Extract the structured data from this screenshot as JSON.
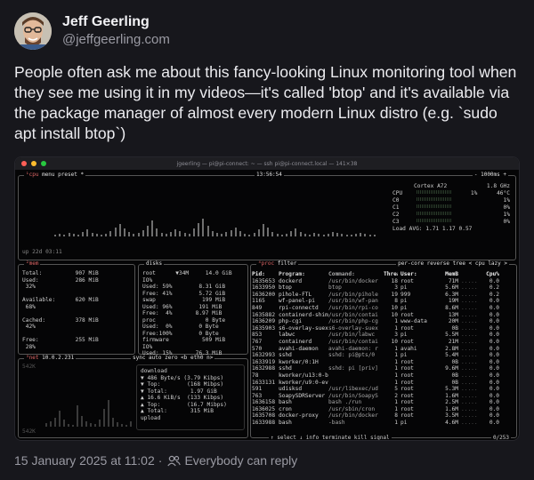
{
  "author": {
    "name": "Jeff Geerling",
    "handle": "@jeffgeerling.com"
  },
  "post": {
    "text": "People often ask me about this fancy-looking Linux monitoring tool when they see me using it in my videos—it's called 'btop' and it's available via the package manager of almost every modern Linux distro (e.g. `sudo apt install btop`)",
    "date": "15 January 2025 at 11:02",
    "reply_setting": "Everybody can reply"
  },
  "screenshot": {
    "window_title": "jgeerling — pi@pi-connect: ~ — ssh pi@pi-connect.local — 141×38",
    "cpu_box_label": "¹cpu",
    "cpu_menu": "menu",
    "cpu_preset": "preset *",
    "clock": "13:56:54",
    "refresh": "- 1000ms +",
    "uptime": "up 22d 03:11",
    "cpu_model": "Cortex A72",
    "cpu_freq": "1.8 GHz",
    "cpu_rows": [
      {
        "label": "CPU",
        "value": "1%",
        "extra": "46°C"
      },
      {
        "label": "C0",
        "value": "",
        "extra": "1%"
      },
      {
        "label": "C1",
        "value": "",
        "extra": "0%"
      },
      {
        "label": "C2",
        "value": "",
        "extra": "1%"
      },
      {
        "label": "C3",
        "value": "",
        "extra": "0%"
      }
    ],
    "load_avg": "Load AVG:   1.71   1.17   0.57",
    "mem": {
      "label": "²mem",
      "lines": [
        "Total:          907 MiB",
        "Used:           286 MiB",
        " 32%",
        "",
        "Available:      620 MiB",
        " 68%",
        "",
        "Cached:         378 MiB",
        " 42%",
        "",
        "Free:           255 MiB",
        " 28%"
      ]
    },
    "disks": {
      "label": "disks",
      "lines": [
        "root      ▼34M     14.0 GiB",
        "IO%",
        "Used: 59%        8.31 GiB",
        "Free: 41%        5.72 GiB",
        "swap              199 MiB",
        "Used: 96%        191 MiB",
        "Free:  4%       8.97 MiB",
        "proc               0 Byte",
        "Used:  0%        0 Byte",
        "Free:100%        0 Byte",
        "firmware          509 MiB",
        "IO%",
        "Used: 15%       76.3 MiB"
      ]
    },
    "net": {
      "label": "³net",
      "ip": "10.0.2.231",
      "controls": "sync  auto  zero  <b eth0 n>",
      "scale_top": "542K",
      "scale_bottom": "542K",
      "lines": [
        "download",
        "▼ 486 Byte/s (3.79 Kibps)",
        "▼ Top:        (168 Mibps)",
        "▼ Total:       1.97 GiB",
        "▲ 16.6 KiB/s  (133 Kibps)",
        "▲ Top:        (16.7 Mibps)",
        "▲ Total:       315 MiB",
        "upload"
      ]
    },
    "proc": {
      "label": "⁴proc",
      "filter": "filter",
      "controls": "per-core  reverse  tree  < cpu lazy >",
      "headers": [
        "Pid:",
        "Program:",
        "Command:",
        "Threads:",
        "User:",
        "MemB",
        "",
        "Cpu%"
      ],
      "rows": [
        [
          "1635653",
          "dockerd",
          "/usr/bin/docker",
          "18",
          "root",
          "71M",
          "",
          "0.0"
        ],
        [
          "1633950",
          "btop",
          "btop",
          "3",
          "pi",
          "5.6M",
          "",
          "0.2"
        ],
        [
          "1636200",
          "pihole-FTL",
          "/usr/bin/pihole",
          "19",
          "999",
          "6.3M",
          "",
          "0.2"
        ],
        [
          "1165",
          "wf-panel-pi",
          "/usr/bin/wf-pan",
          "8",
          "pi",
          "19M",
          "",
          "0.0"
        ],
        [
          "849",
          "rpi-connectd",
          "/usr/bin/rpi-co",
          "10",
          "pi",
          "8.6M",
          "",
          "0.0"
        ],
        [
          "1635882",
          "containerd-shim",
          "/usr/bin/contai",
          "10",
          "root",
          "13M",
          "",
          "0.0"
        ],
        [
          "1636209",
          "php-cgi",
          "/usr/bin/php-cg",
          "1",
          "www-data",
          "20M",
          "",
          "0.0"
        ],
        [
          "1635903",
          "s6-overlay-suex",
          "s6-overlay-suex",
          "1",
          "root",
          "0B",
          "",
          "0.0"
        ],
        [
          "853",
          "labwc",
          "/usr/bin/labwc",
          "3",
          "pi",
          "5.5M",
          "",
          "0.0"
        ],
        [
          "767",
          "containerd",
          "/usr/bin/contai",
          "10",
          "root",
          "21M",
          "",
          "0.0"
        ],
        [
          "570",
          "avahi-daemon",
          "avahi-daemon: r",
          "1",
          "avahi",
          "2.8M",
          "",
          "0.0"
        ],
        [
          "1632993",
          "sshd",
          "sshd: pi@pts/0",
          "1",
          "pi",
          "5.4M",
          "",
          "0.0"
        ],
        [
          "1633919",
          "kworker/0:1H",
          "",
          "1",
          "root",
          "0B",
          "",
          "0.0"
        ],
        [
          "1632988",
          "sshd",
          "sshd: pi [priv]",
          "1",
          "root",
          "9.6M",
          "",
          "0.0"
        ],
        [
          "78",
          "kworker/u13:0-br",
          "",
          "1",
          "root",
          "0B",
          "",
          "0.0"
        ],
        [
          "1633131",
          "kworker/u9:0-eve",
          "",
          "1",
          "root",
          "0B",
          "",
          "0.0"
        ],
        [
          "591",
          "udisksd",
          "/usr/libexec/ud",
          "5",
          "root",
          "5.3M",
          "",
          "0.0"
        ],
        [
          "763",
          "SoapySDRServer",
          "/usr/bin/SoapyS",
          "2",
          "root",
          "1.6M",
          "",
          "0.0"
        ],
        [
          "1636158",
          "bash",
          "bash ./run",
          "1",
          "root",
          "2.5M",
          "",
          "0.0"
        ],
        [
          "1636025",
          "cron",
          "/usr/sbin/cron",
          "1",
          "root",
          "1.6M",
          "",
          "0.0"
        ],
        [
          "1635708",
          "docker-proxy",
          "/usr/bin/docker",
          "8",
          "root",
          "3.5M",
          "",
          "0.0"
        ],
        [
          "1633988",
          "bash",
          "-bash",
          "1",
          "pi",
          "4.6M",
          "",
          "0.0"
        ]
      ],
      "footer": "↑ select ↓ info  terminate  kill  signal",
      "count": "0/253"
    }
  },
  "colors": {
    "accent_red": "#d66666",
    "graph_green": "#3d7a3d",
    "mem_purple": "#7a5fa8"
  },
  "icons": {
    "people": "people-icon"
  }
}
